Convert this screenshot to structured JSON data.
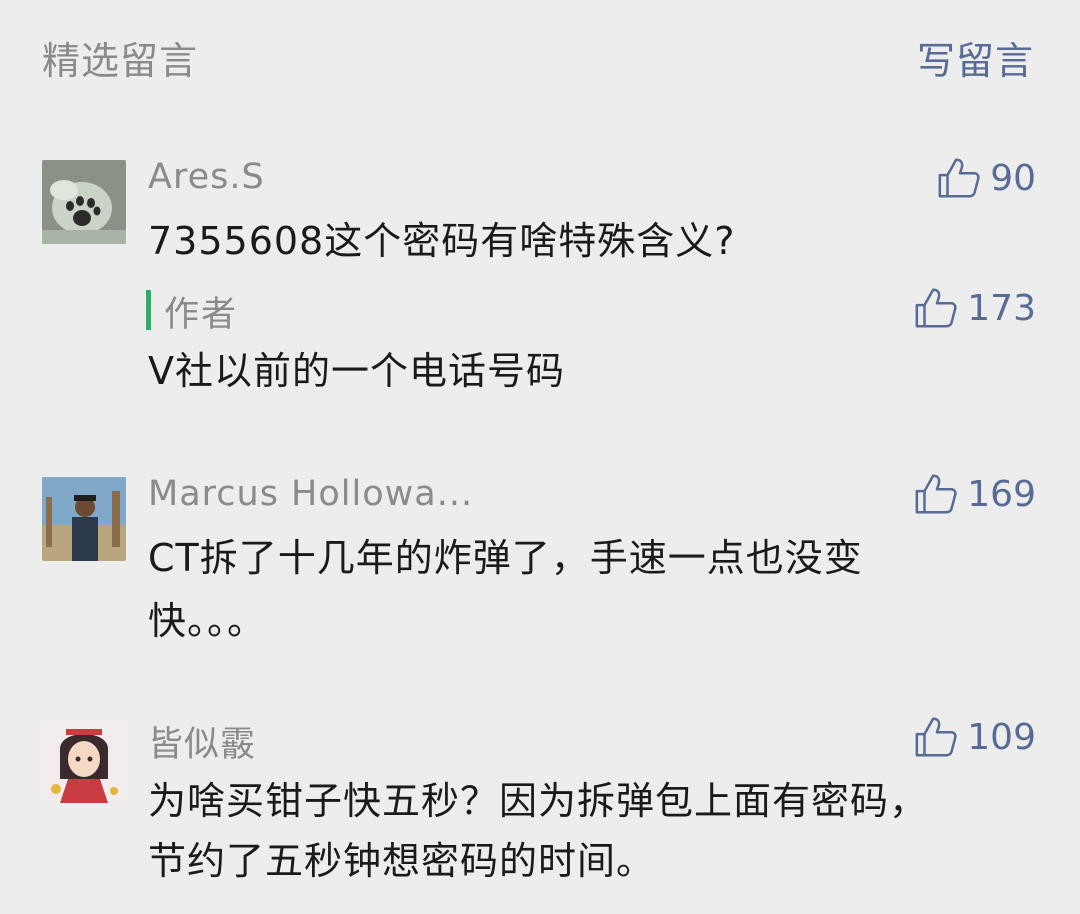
{
  "header": {
    "title": "精选留言",
    "write_label": "写留言"
  },
  "comments": [
    {
      "name": "Ares.S",
      "likes": "90",
      "lines": [
        "7355608这个密码有啥特殊含义?"
      ],
      "reply": {
        "label": "作者",
        "likes": "173",
        "text": "V社以前的一个电话号码"
      }
    },
    {
      "name": "Marcus Hollowa...",
      "likes": "169",
      "lines": [
        "CT拆了十几年的炸弹了，手速一点也没变",
        "快。。。"
      ]
    },
    {
      "name": "皆似霰",
      "likes": "109",
      "lines": [
        "为啥买钳子快五秒？因为拆弹包上面有密码，",
        "节约了五秒钟想密码的时间。"
      ]
    }
  ],
  "colors": {
    "background": "#ededed",
    "link": "#576b95",
    "muted": "#8a8a8a",
    "text": "#1a1a1a",
    "author_bar": "#2aae67"
  },
  "icons": {
    "like": "thumbs-up-icon"
  }
}
